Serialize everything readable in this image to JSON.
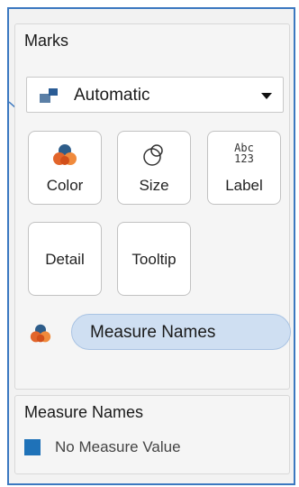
{
  "marks": {
    "title": "Marks",
    "mark_type": {
      "label": "Automatic",
      "icon": "automatic-mark-icon"
    },
    "buttons": {
      "color": {
        "label": "Color",
        "icon": "color-circles-icon"
      },
      "size": {
        "label": "Size",
        "icon": "size-circles-icon"
      },
      "label": {
        "label": "Label",
        "icon": "abc-123-icon",
        "icon_text_top": "Abc",
        "icon_text_bottom": "123"
      },
      "detail": {
        "label": "Detail"
      },
      "tooltip": {
        "label": "Tooltip"
      }
    },
    "field_pill": {
      "label": "Measure Names",
      "icon": "color-circles-icon"
    }
  },
  "legend": {
    "title": "Measure Names",
    "items": [
      {
        "label": "No Measure Value",
        "color": "#1f72b8"
      }
    ]
  },
  "colors": {
    "frame_border": "#3b78c0",
    "pill_fill": "#cfdff2",
    "color_icon_blue": "#2e5d8a",
    "color_icon_orange": "#e2652b"
  }
}
